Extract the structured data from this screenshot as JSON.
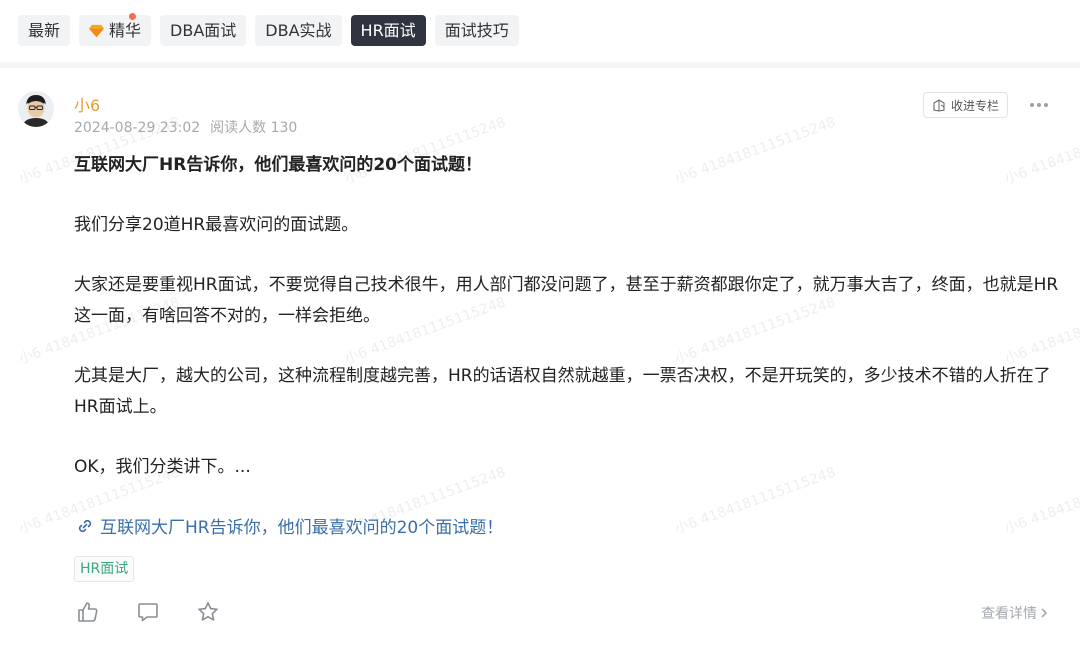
{
  "tabs": [
    {
      "label": "最新",
      "active": false
    },
    {
      "label": "精华",
      "active": false,
      "has_dot": true,
      "icon": "gem-icon"
    },
    {
      "label": "DBA面试",
      "active": false
    },
    {
      "label": "DBA实战",
      "active": false
    },
    {
      "label": "HR面试",
      "active": true
    },
    {
      "label": "面试技巧",
      "active": false
    }
  ],
  "post": {
    "author": "小6",
    "date": "2024-08-29 23:02",
    "reads": "阅读人数 130",
    "collect_label": "收进专栏",
    "title": "互联网大厂HR告诉你，他们最喜欢问的20个面试题！",
    "paragraphs": [
      "我们分享20道HR最喜欢问的面试题。",
      "大家还是要重视HR面试，不要觉得自己技术很牛，用人部门都没问题了，甚至于薪资都跟你定了，就万事大吉了，终面，也就是HR这一面，有啥回答不对的，一样会拒绝。",
      "尤其是大厂，越大的公司，这种流程制度越完善，HR的话语权自然就越重，一票否决权，不是开玩笑的，多少技术不错的人折在了HR面试上。",
      "OK，我们分类讲下。..."
    ],
    "link_text": "互联网大厂HR告诉你，他们最喜欢问的20个面试题！",
    "tag": "HR面试",
    "detail_label": "查看详情"
  },
  "watermark": "小6 4184181115115248",
  "colors": {
    "active_tab_bg": "#2f3440",
    "author": "#e79c38",
    "link": "#3a6ea8",
    "tag": "#3aa87a"
  }
}
